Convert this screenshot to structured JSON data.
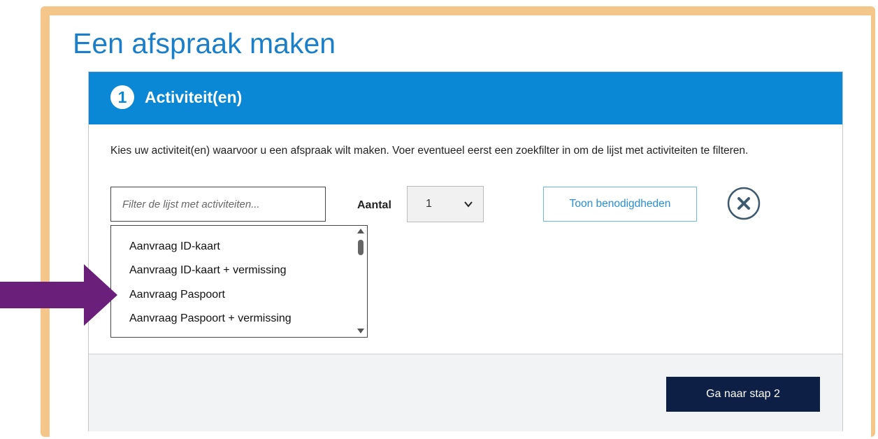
{
  "page": {
    "title": "Een afspraak maken"
  },
  "step": {
    "number": "1",
    "title": "Activiteit(en)"
  },
  "intro_text": "Kies uw activiteit(en) waarvoor u een afspraak wilt maken. Voer eventueel eerst een zoekfilter in om de lijst met activiteiten te filteren.",
  "filter": {
    "placeholder": "Filter de lijst met activiteiten...",
    "value": ""
  },
  "aantal": {
    "label": "Aantal",
    "selected": "1"
  },
  "toon_button": "Toon benodigdheden",
  "activities": [
    "Aanvraag ID-kaart",
    "Aanvraag ID-kaart + vermissing",
    "Aanvraag Paspoort",
    "Aanvraag Paspoort + vermissing"
  ],
  "next_button": "Ga naar stap 2",
  "colors": {
    "frame": "#f5c68a",
    "header": "#0a88d6",
    "title": "#1a7fc8",
    "next_button": "#0d1f45",
    "arrow": "#6a1f7a"
  },
  "icons": [
    "close-circle-icon",
    "chevron-down-icon",
    "arrow-right-icon"
  ]
}
